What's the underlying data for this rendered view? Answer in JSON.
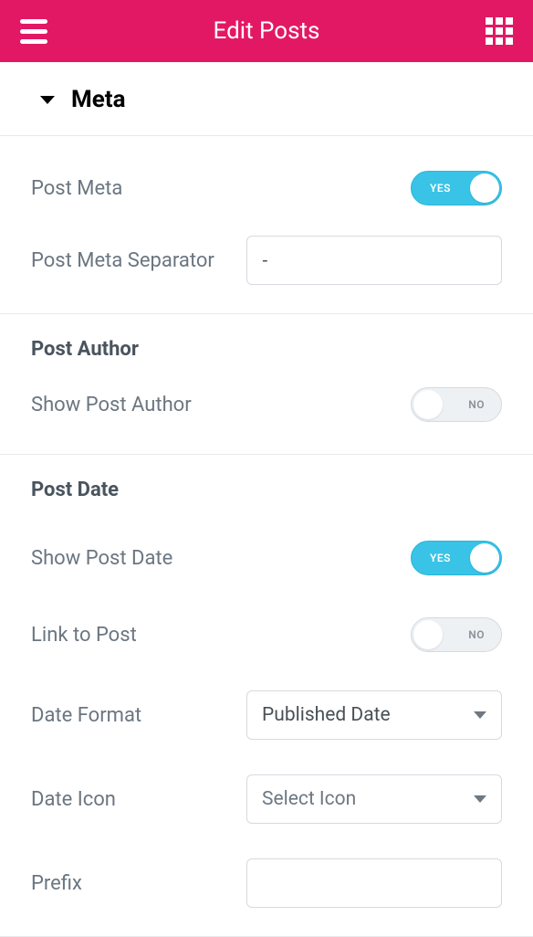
{
  "header": {
    "title": "Edit Posts"
  },
  "section": {
    "title": "Meta"
  },
  "toggle": {
    "yes": "YES",
    "no": "NO"
  },
  "meta": {
    "post_meta_label": "Post Meta",
    "separator_label": "Post Meta Separator",
    "separator_value": "-"
  },
  "author": {
    "heading": "Post Author",
    "show_label": "Show Post Author"
  },
  "date": {
    "heading": "Post Date",
    "show_label": "Show Post Date",
    "link_label": "Link to Post",
    "format_label": "Date Format",
    "format_value": "Published Date",
    "icon_label": "Date Icon",
    "icon_placeholder": "Select Icon",
    "prefix_label": "Prefix",
    "prefix_value": ""
  }
}
